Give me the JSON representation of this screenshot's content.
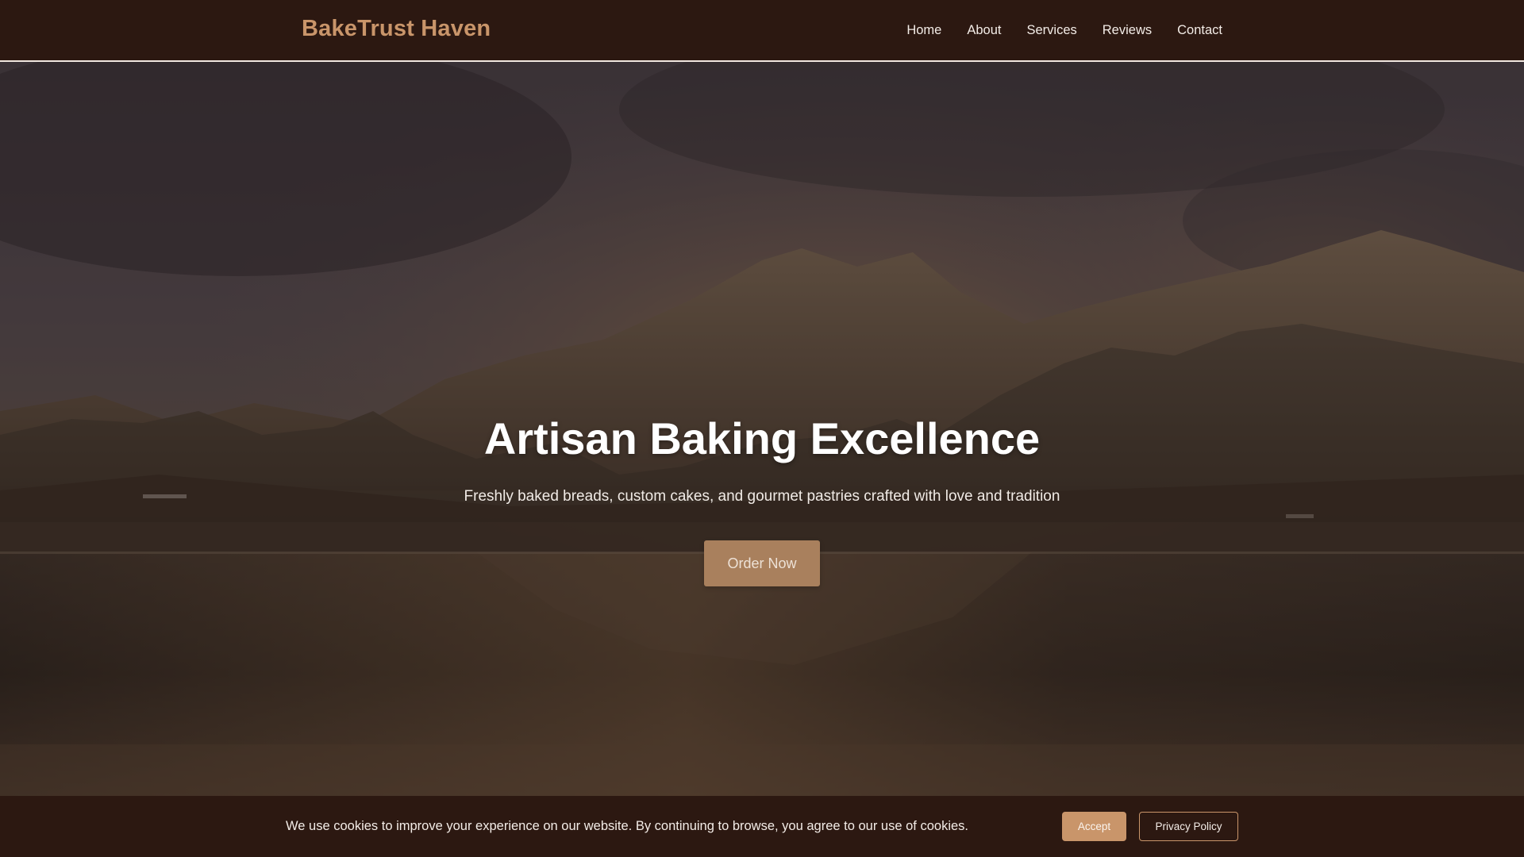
{
  "header": {
    "brand": "BakeTrust Haven",
    "nav": [
      {
        "label": "Home"
      },
      {
        "label": "About"
      },
      {
        "label": "Services"
      },
      {
        "label": "Reviews"
      },
      {
        "label": "Contact"
      }
    ]
  },
  "hero": {
    "title": "Artisan Baking Excellence",
    "subtitle": "Freshly baked breads, custom cakes, and gourmet pastries crafted with love and tradition",
    "cta_label": "Order Now",
    "background": "mountain-lake-landscape-photo"
  },
  "cookie_banner": {
    "message": "We use cookies to improve your experience on our website. By continuing to browse, you agree to our use of cookies.",
    "accept_label": "Accept",
    "privacy_label": "Privacy Policy"
  },
  "colors": {
    "header_bg": "#2c1811",
    "brand": "#c9956a",
    "accent_button": "#c9956a",
    "cta_button": "#a9805d",
    "text_light": "#f3ece7"
  }
}
